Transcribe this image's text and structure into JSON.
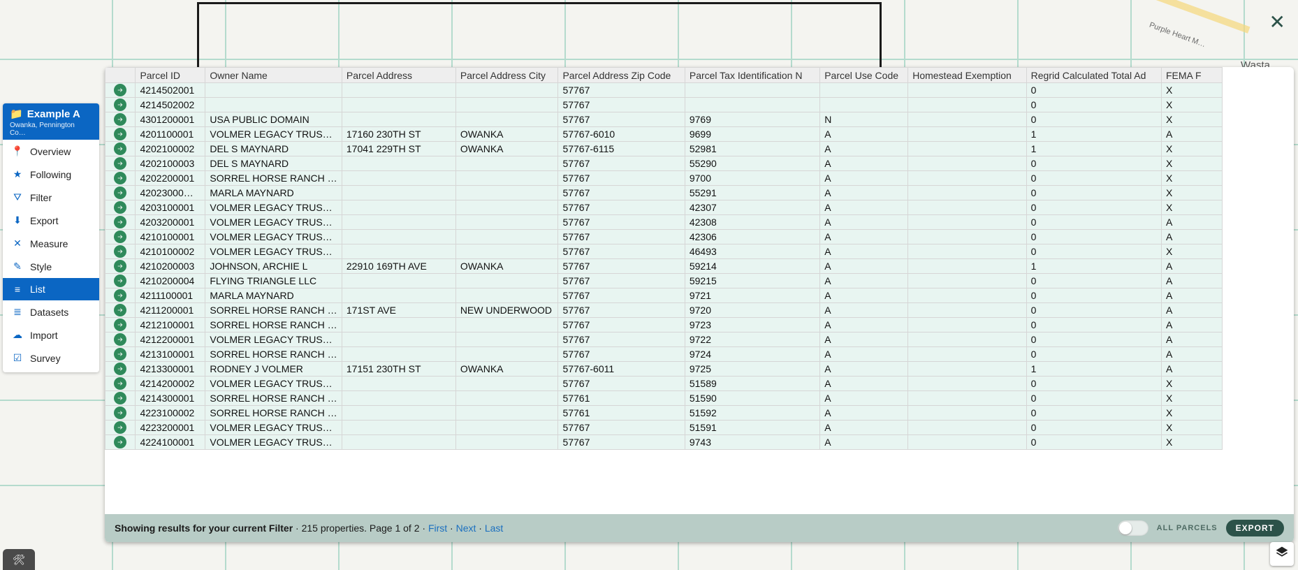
{
  "map": {
    "road_label": "Purple Heart M…",
    "town_label": "Wasta"
  },
  "sidebar": {
    "header_title": "Example A",
    "header_subtitle": "Owanka, Pennington Co…",
    "items": [
      {
        "label": "Overview",
        "icon": "📍"
      },
      {
        "label": "Following",
        "icon": "★"
      },
      {
        "label": "Filter",
        "icon": "⛛"
      },
      {
        "label": "Export",
        "icon": "⬇"
      },
      {
        "label": "Measure",
        "icon": "✕"
      },
      {
        "label": "Style",
        "icon": "✎"
      },
      {
        "label": "List",
        "icon": "≡",
        "active": true
      },
      {
        "label": "Datasets",
        "icon": "≣"
      },
      {
        "label": "Import",
        "icon": "☁"
      },
      {
        "label": "Survey",
        "icon": "☑"
      }
    ]
  },
  "table": {
    "columns": [
      "",
      "Parcel ID",
      "Owner Name",
      "Parcel Address",
      "Parcel Address City",
      "Parcel Address Zip Code",
      "Parcel Tax Identification N",
      "Parcel Use Code",
      "Homestead Exemption",
      "Regrid Calculated Total Ad",
      "FEMA F"
    ],
    "rows": [
      [
        "4214502001",
        "",
        "",
        "",
        "57767",
        "",
        "",
        "",
        "0",
        "X"
      ],
      [
        "4214502002",
        "",
        "",
        "",
        "57767",
        "",
        "",
        "",
        "0",
        "X"
      ],
      [
        "4301200001",
        "USA PUBLIC DOMAIN",
        "",
        "",
        "57767",
        "9769",
        "N",
        "",
        "0",
        "X"
      ],
      [
        "4201100001",
        "VOLMER LEGACY TRUST…",
        "17160 230TH ST",
        "OWANKA",
        "57767-6010",
        "9699",
        "A",
        "",
        "1",
        "A"
      ],
      [
        "4202100002",
        "DEL S MAYNARD",
        "17041 229TH ST",
        "OWANKA",
        "57767-6115",
        "52981",
        "A",
        "",
        "1",
        "X"
      ],
      [
        "4202100003",
        "DEL S MAYNARD",
        "",
        "",
        "57767",
        "55290",
        "A",
        "",
        "0",
        "X"
      ],
      [
        "4202200001",
        "SORREL HORSE RANCH …",
        "",
        "",
        "57767",
        "9700",
        "A",
        "",
        "0",
        "X"
      ],
      [
        "42023000…",
        "MARLA MAYNARD",
        "",
        "",
        "57767",
        "55291",
        "A",
        "",
        "0",
        "X"
      ],
      [
        "4203100001",
        "VOLMER LEGACY TRUST…",
        "",
        "",
        "57767",
        "42307",
        "A",
        "",
        "0",
        "X"
      ],
      [
        "4203200001",
        "VOLMER LEGACY TRUST…",
        "",
        "",
        "57767",
        "42308",
        "A",
        "",
        "0",
        "A"
      ],
      [
        "4210100001",
        "VOLMER LEGACY TRUST…",
        "",
        "",
        "57767",
        "42306",
        "A",
        "",
        "0",
        "A"
      ],
      [
        "4210100002",
        "VOLMER LEGACY TRUST…",
        "",
        "",
        "57767",
        "46493",
        "A",
        "",
        "0",
        "X"
      ],
      [
        "4210200003",
        "JOHNSON, ARCHIE L",
        "22910 169TH AVE",
        "OWANKA",
        "57767",
        "59214",
        "A",
        "",
        "1",
        "A"
      ],
      [
        "4210200004",
        "FLYING TRIANGLE LLC",
        "",
        "",
        "57767",
        "59215",
        "A",
        "",
        "0",
        "A"
      ],
      [
        "4211100001",
        "MARLA MAYNARD",
        "",
        "",
        "57767",
        "9721",
        "A",
        "",
        "0",
        "A"
      ],
      [
        "4211200001",
        "SORREL HORSE RANCH …",
        "171ST AVE",
        "NEW UNDERWOOD",
        "57767",
        "9720",
        "A",
        "",
        "0",
        "A"
      ],
      [
        "4212100001",
        "SORREL HORSE RANCH …",
        "",
        "",
        "57767",
        "9723",
        "A",
        "",
        "0",
        "A"
      ],
      [
        "4212200001",
        "VOLMER LEGACY TRUST…",
        "",
        "",
        "57767",
        "9722",
        "A",
        "",
        "0",
        "A"
      ],
      [
        "4213100001",
        "SORREL HORSE RANCH …",
        "",
        "",
        "57767",
        "9724",
        "A",
        "",
        "0",
        "A"
      ],
      [
        "4213300001",
        "RODNEY J VOLMER",
        "17151 230TH ST",
        "OWANKA",
        "57767-6011",
        "9725",
        "A",
        "",
        "1",
        "A"
      ],
      [
        "4214200002",
        "VOLMER LEGACY TRUST…",
        "",
        "",
        "57767",
        "51589",
        "A",
        "",
        "0",
        "X"
      ],
      [
        "4214300001",
        "SORREL HORSE RANCH …",
        "",
        "",
        "57761",
        "51590",
        "A",
        "",
        "0",
        "X"
      ],
      [
        "4223100002",
        "SORREL HORSE RANCH …",
        "",
        "",
        "57761",
        "51592",
        "A",
        "",
        "0",
        "X"
      ],
      [
        "4223200001",
        "VOLMER LEGACY TRUST…",
        "",
        "",
        "57767",
        "51591",
        "A",
        "",
        "0",
        "X"
      ],
      [
        "4224100001",
        "VOLMER LEGACY TRUST…",
        "",
        "",
        "57767",
        "9743",
        "A",
        "",
        "0",
        "X"
      ]
    ]
  },
  "footer": {
    "status_bold": "Showing results for your current Filter",
    "status_rest": " · 215 properties. Page 1 of 2 · ",
    "link_first": "First",
    "link_next": "Next",
    "link_last": "Last",
    "sep": " · ",
    "toggle_label": "ALL PARCELS",
    "export_label": "EXPORT"
  }
}
